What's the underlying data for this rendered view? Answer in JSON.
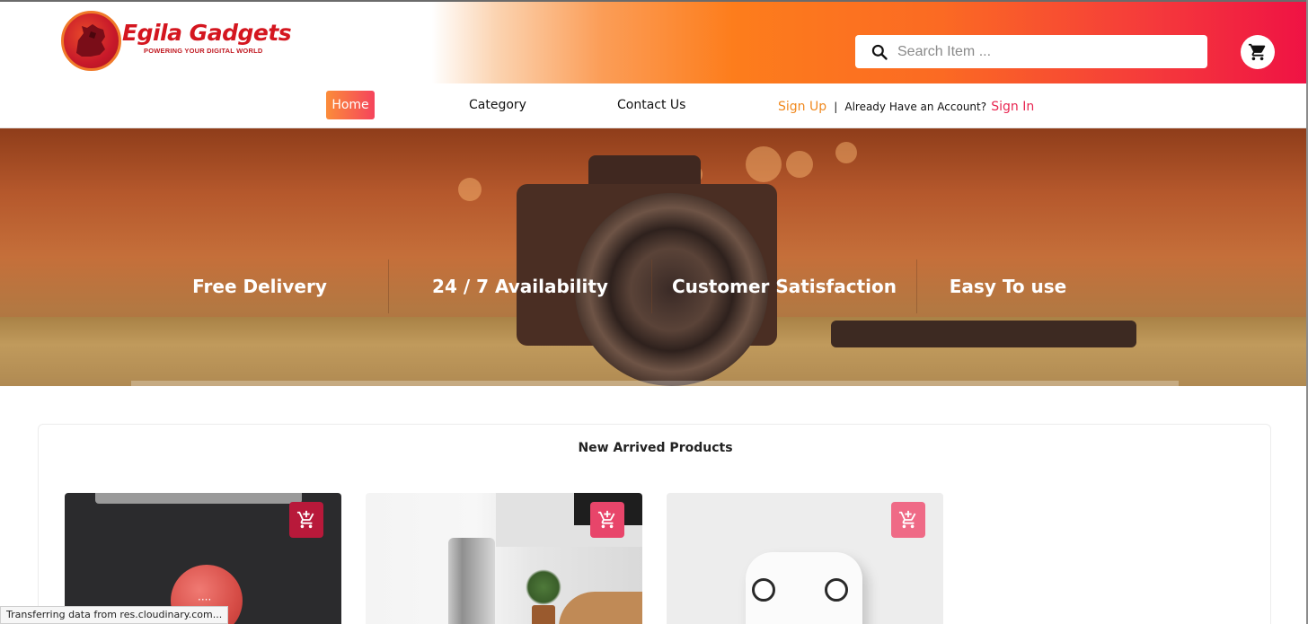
{
  "brand": {
    "name": "Egila Gadgets",
    "tagline": "POWERING YOUR DIGITAL WORLD"
  },
  "search": {
    "placeholder": "Search Item ..."
  },
  "nav": {
    "home": "Home",
    "category": "Category",
    "contact": "Contact Us",
    "signup": "Sign Up",
    "separator": "|",
    "already": "Already Have an Account?",
    "signin": "Sign In"
  },
  "features": [
    "Free Delivery",
    "24 / 7 Availability",
    "Customer Satisfaction",
    "Easy To use"
  ],
  "products": {
    "title": "New Arrived Products",
    "items": [
      {
        "image": "red smart speaker on dark felt",
        "cart_icon": "add-to-cart-icon"
      },
      {
        "image": "laptop with plant on desk",
        "cart_icon": "add-to-cart-icon"
      },
      {
        "image": "white wireless earbuds in case",
        "cart_icon": "add-to-cart-icon"
      }
    ]
  },
  "status_bar": "Transferring data from res.cloudinary.com...",
  "colors": {
    "accent_orange": "#f0891f",
    "accent_pink": "#e82651",
    "cart_button": "#c8193a"
  }
}
